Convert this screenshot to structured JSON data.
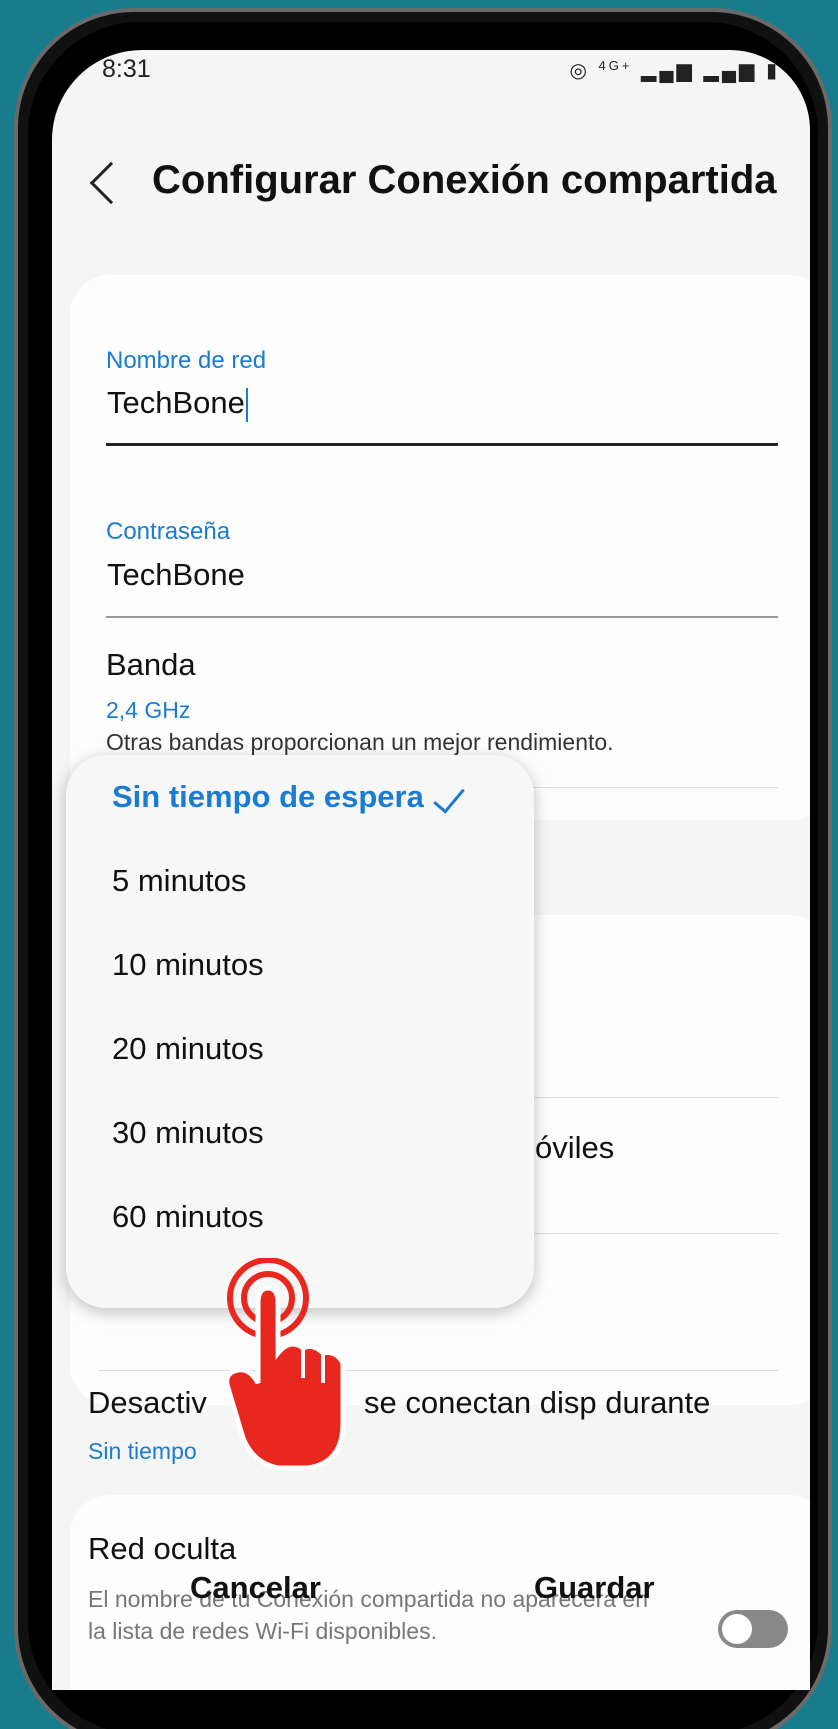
{
  "status_bar": {
    "time": "8:31",
    "icons": [
      "hotspot-icon",
      "4g-icon",
      "signal-icon",
      "signal-icon",
      "battery-icon"
    ],
    "network_label": "4G+"
  },
  "header": {
    "title": "Configurar Conexión compartida",
    "back_icon": "chevron-left-icon"
  },
  "network_name": {
    "label": "Nombre de red",
    "value": "TechBone"
  },
  "password": {
    "label": "Contraseña",
    "value": "TechBone"
  },
  "band": {
    "title": "Banda",
    "value": "2,4 GHz",
    "note": "Otras bandas proporcionan un mejor rendimiento."
  },
  "partial_rows": {
    "moviles_fragment": "óviles",
    "desactivar_prefix": "Desactiv",
    "desactivar_suffix": "se conectan disp durante",
    "desactivar_value": "Sin tiempo"
  },
  "hidden_network": {
    "title": "Red oculta",
    "description": "El nombre de tu Conexión compartida no aparecerá en la lista de redes Wi-Fi disponibles.",
    "toggle_on": false
  },
  "buttons": {
    "cancel": "Cancelar",
    "save": "Guardar"
  },
  "timeout_menu": {
    "options": [
      {
        "label": "Sin tiempo de espera",
        "selected": true
      },
      {
        "label": "5 minutos",
        "selected": false
      },
      {
        "label": "10 minutos",
        "selected": false
      },
      {
        "label": "20 minutos",
        "selected": false
      },
      {
        "label": "30 minutos",
        "selected": false
      },
      {
        "label": "60 minutos",
        "selected": false
      }
    ]
  },
  "colors": {
    "accent": "#1a7bd3",
    "background": "#187c8c",
    "tap_indicator": "#e8281f"
  }
}
